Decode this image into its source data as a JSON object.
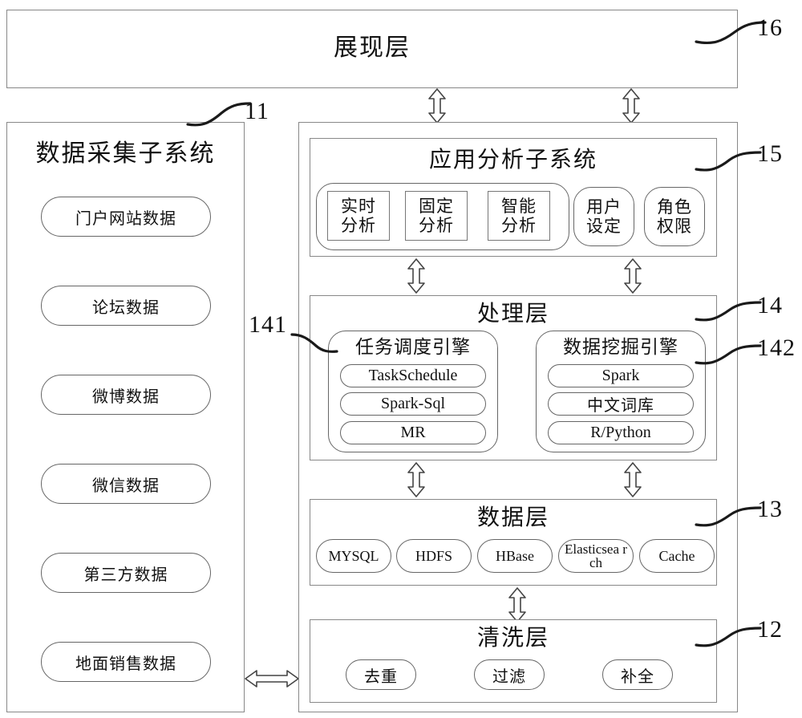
{
  "diagram": {
    "presentation_layer": {
      "title": "展现层",
      "ref": "16"
    },
    "collection_subsystem": {
      "title": "数据采集子系统",
      "ref": "11",
      "items": [
        {
          "label": "门户网站数据"
        },
        {
          "label": "论坛数据"
        },
        {
          "label": "微博数据"
        },
        {
          "label": "微信数据"
        },
        {
          "label": "第三方数据"
        },
        {
          "label": "地面销售数据"
        }
      ]
    },
    "analysis_subsystem": {
      "title": "应用分析子系统",
      "ref": "15",
      "analysis_modes": [
        {
          "label": "实时\n分析"
        },
        {
          "label": "固定\n分析"
        },
        {
          "label": "智能\n分析"
        }
      ],
      "extras": [
        {
          "label": "用户\n设定"
        },
        {
          "label": "角色\n权限"
        }
      ]
    },
    "processing_layer": {
      "title": "处理层",
      "ref": "14",
      "engines": [
        {
          "title": "任务调度引擎",
          "ref": "141",
          "items": [
            {
              "label": "TaskSchedule"
            },
            {
              "label": "Spark-Sql"
            },
            {
              "label": "MR"
            }
          ]
        },
        {
          "title": "数据挖掘引擎",
          "ref": "142",
          "items": [
            {
              "label": "Spark"
            },
            {
              "label": "中文词库"
            },
            {
              "label": "R/Python"
            }
          ]
        }
      ]
    },
    "data_layer": {
      "title": "数据层",
      "ref": "13",
      "stores": [
        {
          "label": "MYSQL"
        },
        {
          "label": "HDFS"
        },
        {
          "label": "HBase"
        },
        {
          "label": "Elasticsea rch"
        },
        {
          "label": "Cache"
        }
      ]
    },
    "cleaning_layer": {
      "title": "清洗层",
      "ref": "12",
      "ops": [
        {
          "label": "去重"
        },
        {
          "label": "过滤"
        },
        {
          "label": "补全"
        }
      ]
    },
    "colors": {
      "stroke": "#777777",
      "text": "#111111",
      "background": "#ffffff"
    }
  }
}
